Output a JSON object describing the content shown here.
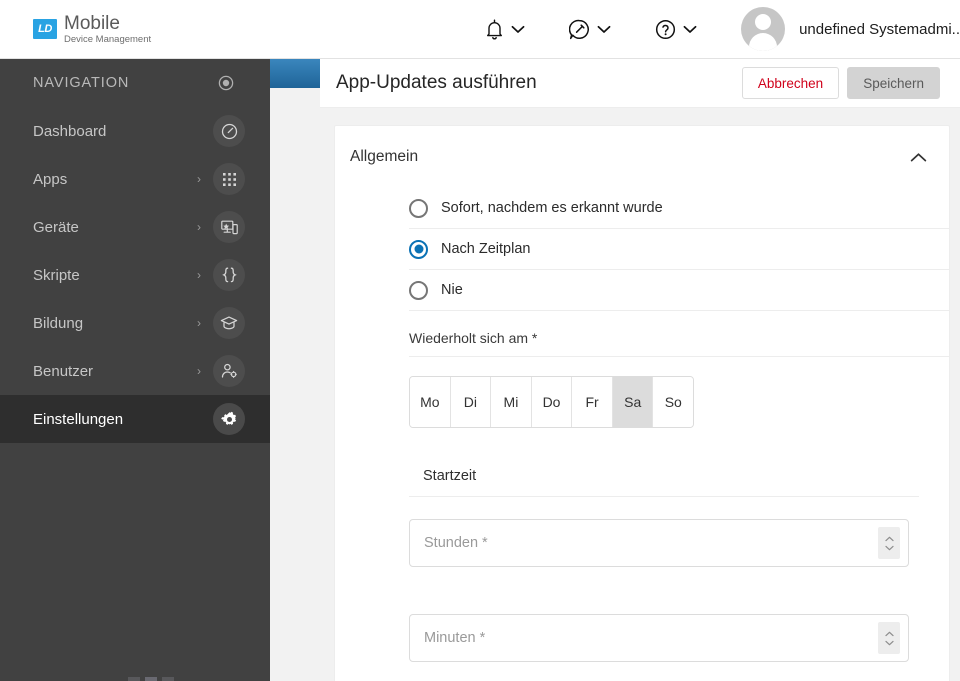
{
  "brand": {
    "badge": "LD",
    "name": "Mobile",
    "tagline": "Device Management",
    "badge_color": "#29a3e3"
  },
  "topbar": {
    "notifications_icon": "bell-icon",
    "feedback_icon": "chat-pencil-icon",
    "help_icon": "help-circle-icon",
    "chevron": "⌄",
    "user_name": "undefined Systemadmi.."
  },
  "sidebar": {
    "heading": "NAVIGATION",
    "collapse_icon": "target-circle-icon",
    "items": [
      {
        "label": "Dashboard",
        "icon": "speedometer-icon",
        "expandable": false,
        "active": false,
        "arrow": ""
      },
      {
        "label": "Apps",
        "icon": "grid-apps-icon",
        "expandable": true,
        "active": false,
        "arrow": "›"
      },
      {
        "label": "Geräte",
        "icon": "devices-icon",
        "expandable": true,
        "active": false,
        "arrow": "›"
      },
      {
        "label": "Skripte",
        "icon": "braces-icon",
        "expandable": true,
        "active": false,
        "arrow": "›"
      },
      {
        "label": "Bildung",
        "icon": "graduation-cap-icon",
        "expandable": true,
        "active": false,
        "arrow": "›"
      },
      {
        "label": "Benutzer",
        "icon": "user-settings-icon",
        "expandable": true,
        "active": false,
        "arrow": "›"
      },
      {
        "label": "Einstellungen",
        "icon": "gear-icon",
        "expandable": false,
        "active": true,
        "arrow": ""
      }
    ]
  },
  "page": {
    "title": "App-Updates ausführen",
    "cancel_label": "Abbrechen",
    "save_label": "Speichern",
    "cancel_color": "#d0021b"
  },
  "card": {
    "title": "Allgemein",
    "collapse_caret": "˄"
  },
  "form": {
    "schedule_options": [
      {
        "label": "Sofort, nachdem es erkannt wurde",
        "selected": false
      },
      {
        "label": "Nach Zeitplan",
        "selected": true
      },
      {
        "label": "Nie",
        "selected": false
      }
    ],
    "repeat_label": "Wiederholt sich am *",
    "days": [
      {
        "label": "Mo",
        "selected": false
      },
      {
        "label": "Di",
        "selected": false
      },
      {
        "label": "Mi",
        "selected": false
      },
      {
        "label": "Do",
        "selected": false
      },
      {
        "label": "Fr",
        "selected": false
      },
      {
        "label": "Sa",
        "selected": true
      },
      {
        "label": "So",
        "selected": false
      }
    ],
    "start_time_label": "Startzeit",
    "hours_placeholder": "Stunden *",
    "hours_value": "",
    "minutes_placeholder": "Minuten *",
    "minutes_value": "",
    "accent_color": "#0b72b5"
  }
}
